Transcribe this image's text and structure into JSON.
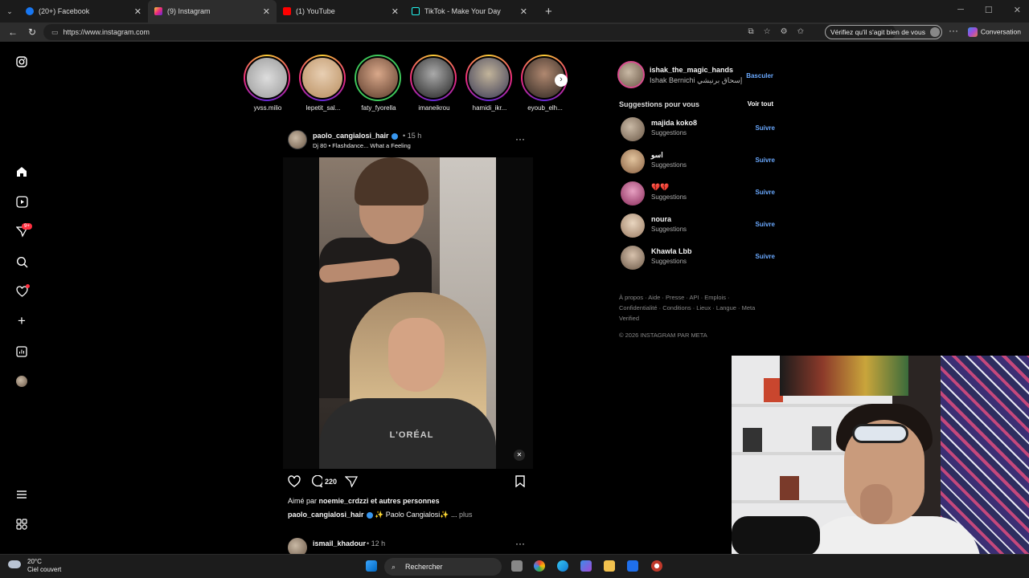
{
  "browser": {
    "tabs": [
      {
        "label": "(20+) Facebook",
        "color": "#1877f2"
      },
      {
        "label": "(9) Instagram",
        "color": "#d6249f"
      },
      {
        "label": "(1) YouTube",
        "color": "#ff0000"
      },
      {
        "label": "TikTok - Make Your Day",
        "color": "#111111"
      }
    ],
    "url": "https://www.instagram.com",
    "verify_text": "Vérifiez qu'il s'agit bien de vous",
    "conversation": "Conversation"
  },
  "sidebar": {
    "badge": "9+"
  },
  "stories": [
    {
      "name": "yvss.milio"
    },
    {
      "name": "lepetit_sal..."
    },
    {
      "name": "faty_fyorella"
    },
    {
      "name": "imaneikrou"
    },
    {
      "name": "hamidi_ikr..."
    },
    {
      "name": "eyoub_elh..."
    }
  ],
  "post": {
    "user": "paolo_cangialosi_hair",
    "time": "15 h",
    "audio": "Dj 80 • Flashdance... What a Feeling",
    "comments": "220",
    "liked_prefix": "Aimé par ",
    "liked_user": "noemie_crdzzi",
    "liked_suffix": " et autres personnes",
    "caption_user": "paolo_cangialosi_hair",
    "caption_text": "✨ Paolo Cangialosi✨ ...",
    "caption_more": "plus",
    "cape_text": "L'ORÉAL"
  },
  "next_post": {
    "user": "ismail_khadour",
    "time": "12 h"
  },
  "profile": {
    "username": "ishak_the_magic_hands",
    "fullname": "Ishak Bernichi إسحاق برنيشي",
    "switch": "Basculer"
  },
  "suggestions": {
    "title": "Suggestions pour vous",
    "see_all": "Voir tout",
    "items": [
      {
        "user": "majida koko8",
        "sub": "Suggestions",
        "action": "Suivre"
      },
      {
        "user": "اسو",
        "sub": "Suggestions",
        "action": "Suivre"
      },
      {
        "user": "💔💔",
        "sub": "Suggestions",
        "action": "Suivre"
      },
      {
        "user": "noura",
        "sub": "Suggestions",
        "action": "Suivre"
      },
      {
        "user": "Khawla Lbb",
        "sub": "Suggestions",
        "action": "Suivre"
      }
    ]
  },
  "footer": {
    "links": "À propos · Aide · Presse · API · Emplois · Confidentialité · Conditions · Lieux · Langue · Meta Verified",
    "copyright": "© 2026 INSTAGRAM PAR META"
  },
  "taskbar": {
    "temp": "20°C",
    "weather": "Ciel couvert",
    "search": "Rechercher"
  }
}
